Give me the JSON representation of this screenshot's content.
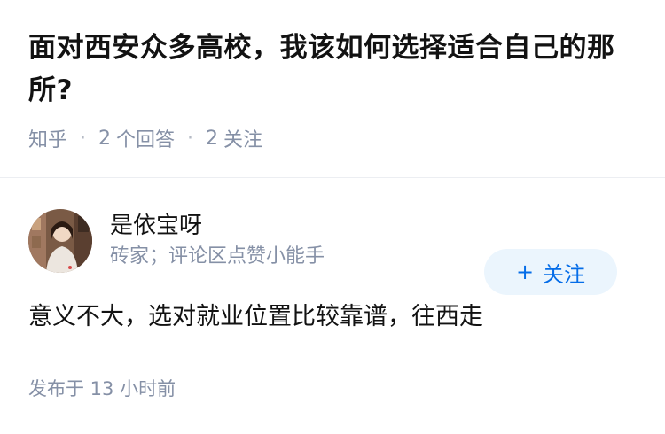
{
  "question": {
    "title": "面对西安众多高校，我该如何选择适合自己的那所?",
    "source": "知乎",
    "answers_count": "2",
    "answers_label": "个回答",
    "followers_count": "2",
    "followers_label": "关注",
    "separator": "·"
  },
  "answer": {
    "author_name": "是依宝呀",
    "author_bio": "砖家；评论区点赞小能手",
    "follow_label": "关注",
    "follow_plus": "+",
    "content": "意义不大，选对就业位置比较靠谱，往西走",
    "published": "发布于 13 小时前"
  },
  "colors": {
    "accent": "#056de8",
    "follow_bg": "#ebf5fd",
    "meta_text": "#8590a6",
    "primary_text": "#121212"
  }
}
